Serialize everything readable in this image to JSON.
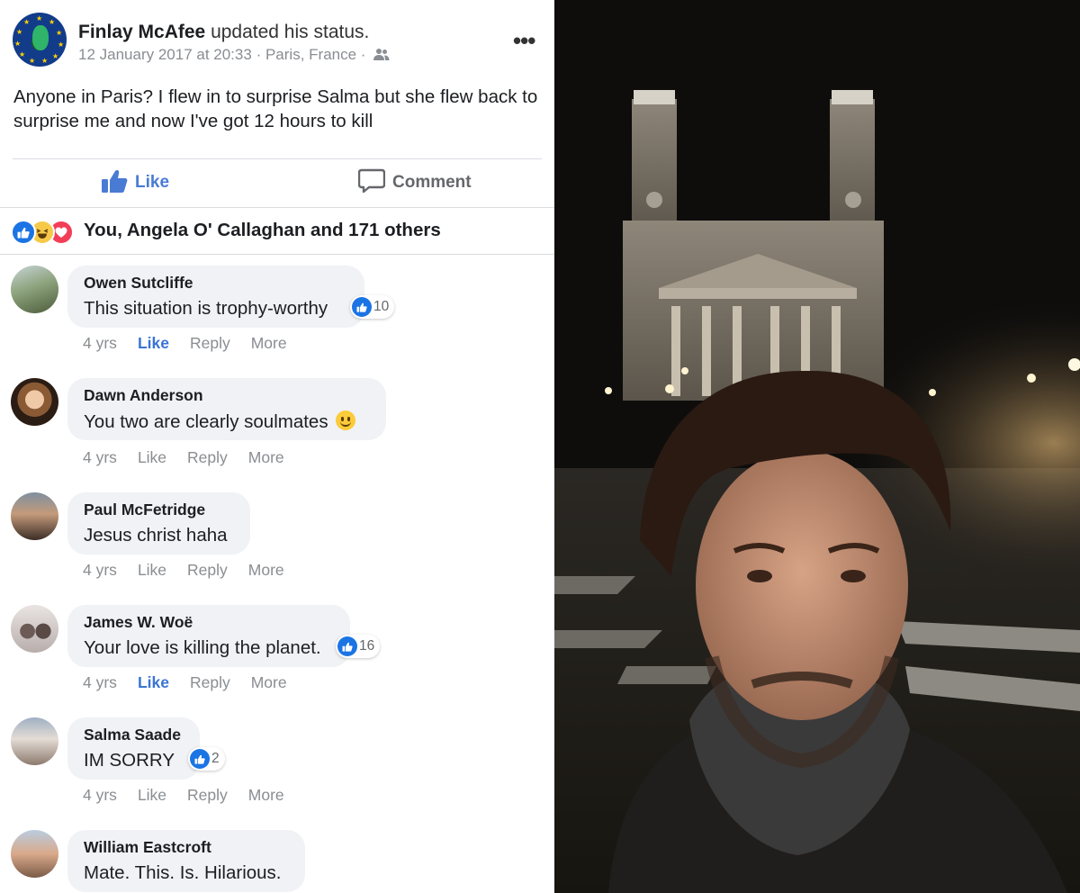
{
  "post": {
    "author": "Finlay McAfee",
    "action": "updated his status.",
    "timestamp": "12 January 2017 at 20:33",
    "location": "Paris, France",
    "separator": "·",
    "audience_icon": "friends-icon",
    "menu_icon": "more-options-icon",
    "text": "Anyone in Paris? I flew in to surprise Salma but she flew back to surprise me and now I've got 12 hours to kill"
  },
  "actions": {
    "like_label": "Like",
    "comment_label": "Comment"
  },
  "reactions": {
    "icons": [
      "like-reaction-icon",
      "haha-reaction-icon",
      "love-reaction-icon"
    ],
    "summary": "You, Angela O' Callaghan and 171 others"
  },
  "comments": [
    {
      "name": "Owen Sutcliffe",
      "text": "This situation is trophy-worthy",
      "likes": "10",
      "age": "4 yrs",
      "like": "Like",
      "reply": "Reply",
      "more": "More",
      "liked": true
    },
    {
      "name": "Dawn Anderson",
      "text": "You two are clearly soulmates",
      "emoji": "smiling-face-emoji",
      "likes": "",
      "age": "4 yrs",
      "like": "Like",
      "reply": "Reply",
      "more": "More",
      "liked": false
    },
    {
      "name": "Paul McFetridge",
      "text": "Jesus christ haha",
      "likes": "",
      "age": "4 yrs",
      "like": "Like",
      "reply": "Reply",
      "more": "More",
      "liked": false
    },
    {
      "name": "James W. Woë",
      "text": "Your love is killing the planet.",
      "likes": "16",
      "age": "4 yrs",
      "like": "Like",
      "reply": "Reply",
      "more": "More",
      "liked": true
    },
    {
      "name": "Salma Saade",
      "text": "IM SORRY",
      "likes": "2",
      "age": "4 yrs",
      "like": "Like",
      "reply": "Reply",
      "more": "More",
      "liked": false
    },
    {
      "name": "William Eastcroft",
      "text": "Mate. This. Is. Hilarious.",
      "likes": "",
      "age": "",
      "like": "",
      "reply": "",
      "more": "",
      "liked": false
    }
  ],
  "colors": {
    "link_blue": "#3a74d4",
    "like_blue": "#1b74e4",
    "bubble_grey": "#f0f2f5",
    "meta_grey": "#8a8d91",
    "haha_yellow": "#f7c948",
    "love_red": "#f33e58"
  },
  "photo": {
    "description_icon": "night-selfie-photo"
  }
}
